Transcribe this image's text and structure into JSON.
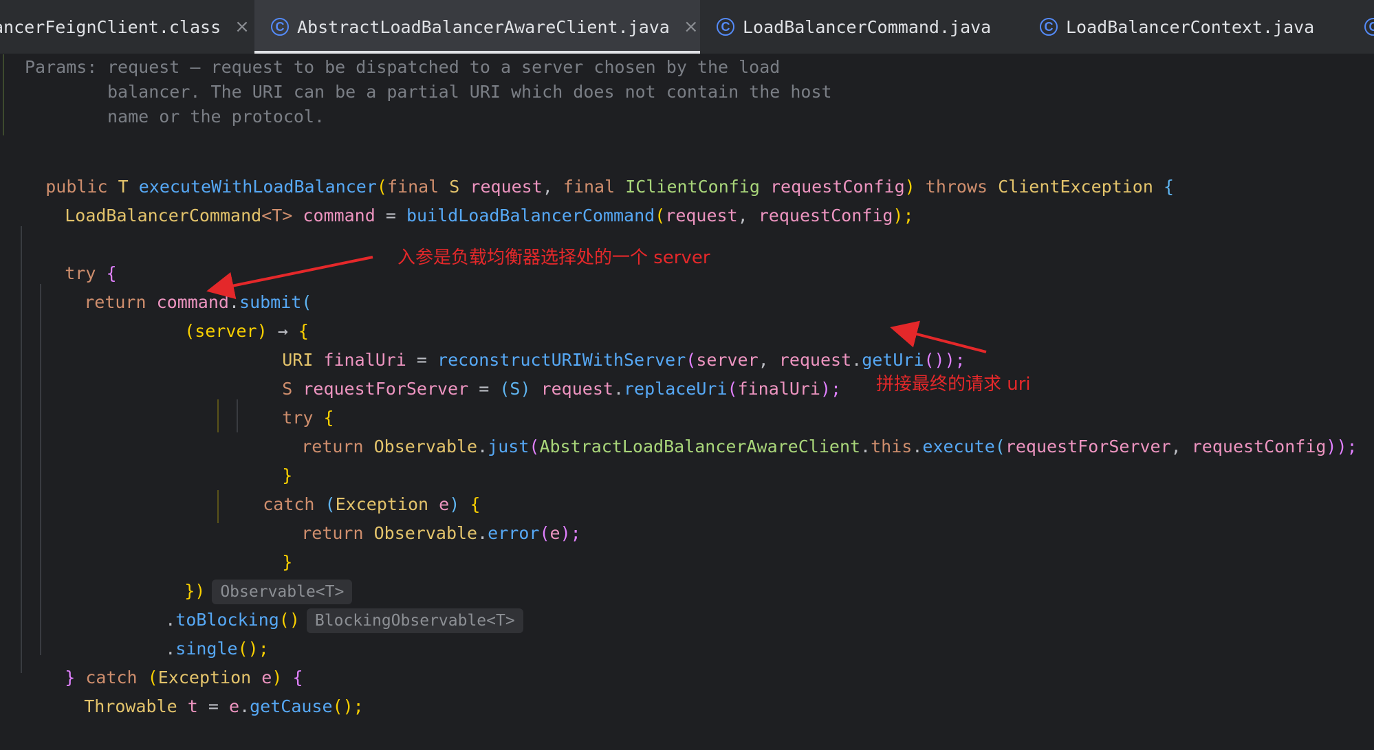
{
  "tabs": [
    {
      "label": "ancerFeignClient.class",
      "active": false,
      "closable": true,
      "icon": "none"
    },
    {
      "label": "AbstractLoadBalancerAwareClient.java",
      "active": true,
      "closable": true,
      "icon": "class-icon"
    },
    {
      "label": "LoadBalancerCommand.java",
      "active": false,
      "closable": false,
      "icon": "class-icon"
    },
    {
      "label": "LoadBalancerContext.java",
      "active": false,
      "closable": false,
      "icon": "class-icon"
    }
  ],
  "doc": {
    "params_label": "Params:",
    "line1": "request – request to be dispatched to a server chosen by the load",
    "line2": "balancer. The URI can be a partial URI which does not contain the host",
    "line3": "name or the protocol."
  },
  "code": {
    "l1": {
      "public": "public",
      "T": "T",
      "method": "executeWithLoadBalancer",
      "p1": "(",
      "final1": "final",
      "S": "S",
      "request": "request",
      "comma": ",",
      "final2": "final",
      "icfg": "IClientConfig",
      "rc": "requestConfig",
      "p2": ")",
      "throws": "throws",
      "ce": "ClientException",
      "brace": "{"
    },
    "l2": {
      "lbc": "LoadBalancerCommand",
      "gen": "<T>",
      "cmd": "command",
      "eq": "=",
      "build": "buildLoadBalancerCommand",
      "args": "(",
      "req": "request",
      "c": ",",
      "rc": "requestConfig",
      "end": ");"
    },
    "try1": "try",
    "brace_open": "{",
    "ret": "return",
    "command": "command",
    "dot": ".",
    "submit": "submit",
    "paren": "(",
    "server_open": "(server)",
    "arrow": "→",
    "lambda_brace": "{",
    "uri": "URI",
    "finalUri": "finalUri",
    "eq": "=",
    "recon": "reconstructURIWithServer",
    "server_arg": "server",
    "req_getUri": "request",
    "getUri": "getUri",
    "recon_end": "());",
    "S": "S",
    "rfs": "requestForServer",
    "cast": "(S)",
    "req": "request",
    "replaceUri": "replaceUri",
    "fu": "finalUri",
    "semi": ");",
    "try2": "try",
    "ret2": "return",
    "obs": "Observable",
    "just": "just",
    "alb": "AbstractLoadBalancerAwareClient",
    "this": "this",
    "execute": "execute",
    "rfs2": "requestForServer",
    "rc2": "requestConfig",
    "end2": "));",
    "close_brace": "}",
    "catch": "catch",
    "exc": "Exception",
    "e": "e",
    "ret3": "return",
    "error": "error",
    "end3": ");",
    "close_lambda": "})",
    "hint1": "Observable<T>",
    "toBlocking": "toBlocking",
    "tb_paren": "()",
    "hint2": "BlockingObservable<T>",
    "single": "single",
    "single_end": "();",
    "catch_outer": "catch",
    "throwable": "Throwable",
    "t": "t",
    "getCause": "getCause"
  },
  "annotations": {
    "a1": "入参是负载均衡器选择处的一个 server",
    "a2": "拼接最终的请求 uri"
  }
}
